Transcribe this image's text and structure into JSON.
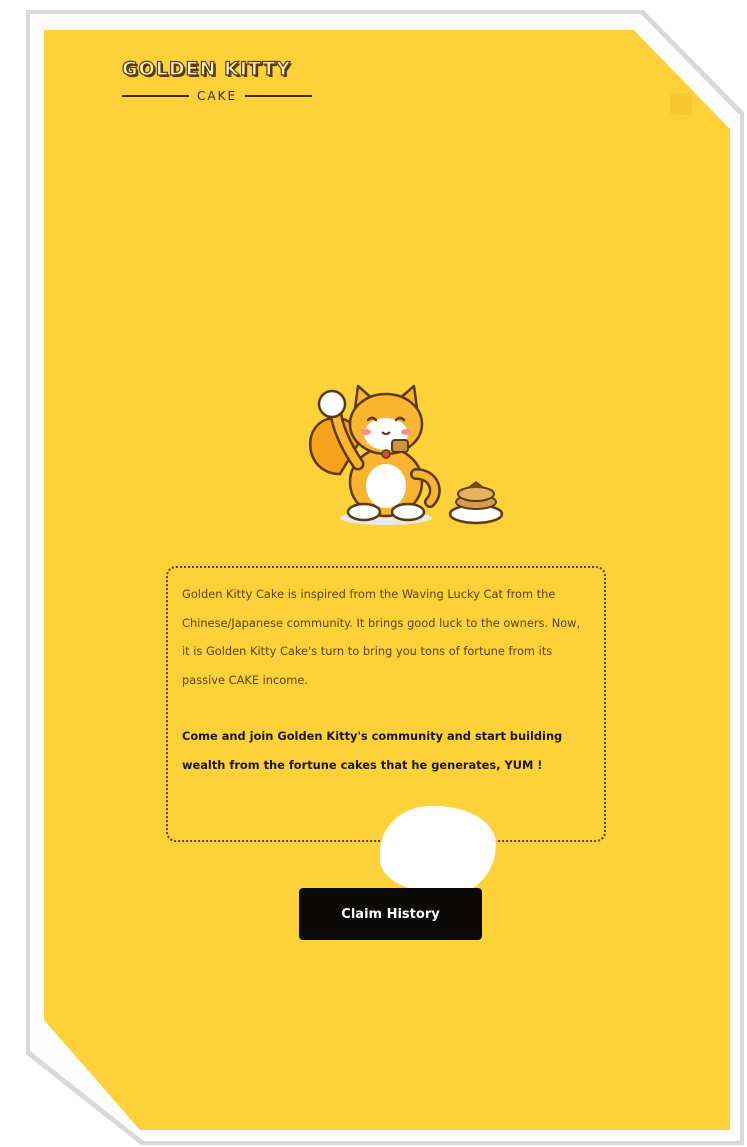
{
  "logo": {
    "word": "GOLDEN KITTY",
    "sub": "CAKE"
  },
  "about": {
    "paragraph": "Golden Kitty Cake is inspired from the Waving Lucky Cat from the Chinese/Japanese community. It brings good luck to the owners. Now, it is Golden Kitty Cake's turn to bring you tons of fortune from its passive CAKE income.",
    "call_to_action": "Come and join Golden Kitty's community and start building wealth from the fortune cakes that he generates, YUM !"
  },
  "actions": {
    "claim_history_label": "Claim History"
  },
  "colors": {
    "panel": "#fdd138",
    "button": "#0b0a08",
    "border": "#5b3a12"
  }
}
